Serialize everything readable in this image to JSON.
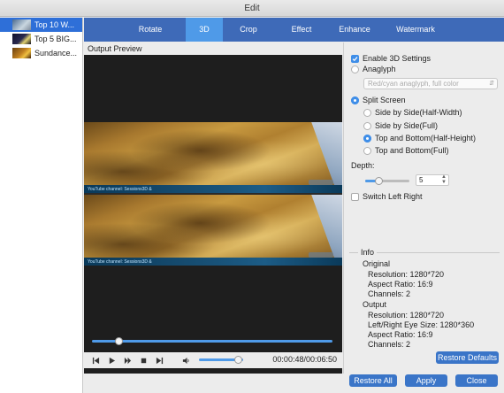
{
  "window": {
    "title": "Edit"
  },
  "files": [
    {
      "name": "Top 10 W...",
      "active": true
    },
    {
      "name": "Top 5 BIG...",
      "active": false
    },
    {
      "name": "Sundance...",
      "active": false
    }
  ],
  "tabs": [
    {
      "label": "Rotate",
      "active": false
    },
    {
      "label": "3D",
      "active": true
    },
    {
      "label": "Crop",
      "active": false
    },
    {
      "label": "Effect",
      "active": false
    },
    {
      "label": "Enhance",
      "active": false
    },
    {
      "label": "Watermark",
      "active": false
    }
  ],
  "preview": {
    "label": "Output Preview",
    "caption": "YouTube channel: Sessions3D &",
    "seek_progress": 0.11,
    "volume_level": 0.88
  },
  "player": {
    "time": "00:00:48/00:06:50",
    "icons": [
      "skip-back-icon",
      "play-icon",
      "fast-forward-icon",
      "stop-icon",
      "skip-forward-icon",
      "volume-icon"
    ]
  },
  "settings": {
    "enable_3d_label": "Enable 3D Settings",
    "enable_3d_checked": true,
    "anaglyph_label": "Anaglyph",
    "anaglyph_selected": false,
    "anaglyph_option": "Red/cyan anaglyph, full color",
    "split_screen_label": "Split Screen",
    "split_screen_selected": true,
    "split_options": [
      {
        "label": "Side by Side(Half-Width)",
        "selected": false
      },
      {
        "label": "Side by Side(Full)",
        "selected": false
      },
      {
        "label": "Top and Bottom(Half-Height)",
        "selected": true
      },
      {
        "label": "Top and Bottom(Full)",
        "selected": false
      }
    ],
    "depth_label": "Depth:",
    "depth_value": "5",
    "depth_level": 0.3,
    "switch_label": "Switch Left Right",
    "switch_checked": false
  },
  "info": {
    "title": "Info",
    "original_label": "Original",
    "original": {
      "resolution": "Resolution: 1280*720",
      "aspect": "Aspect Ratio: 16:9",
      "channels": "Channels: 2"
    },
    "output_label": "Output",
    "output": {
      "resolution": "Resolution: 1280*720",
      "eye_size": "Left/Right Eye Size: 1280*360",
      "aspect": "Aspect Ratio: 16:9",
      "channels": "Channels: 2"
    }
  },
  "buttons": {
    "restore_defaults": "Restore Defaults",
    "restore_all": "Restore All",
    "apply": "Apply",
    "close": "Close"
  },
  "colors": {
    "tab_bar": "#3e6ab8",
    "tab_active": "#4f9ae8",
    "button": "#3a75c8",
    "accent": "#3f8ee8"
  }
}
